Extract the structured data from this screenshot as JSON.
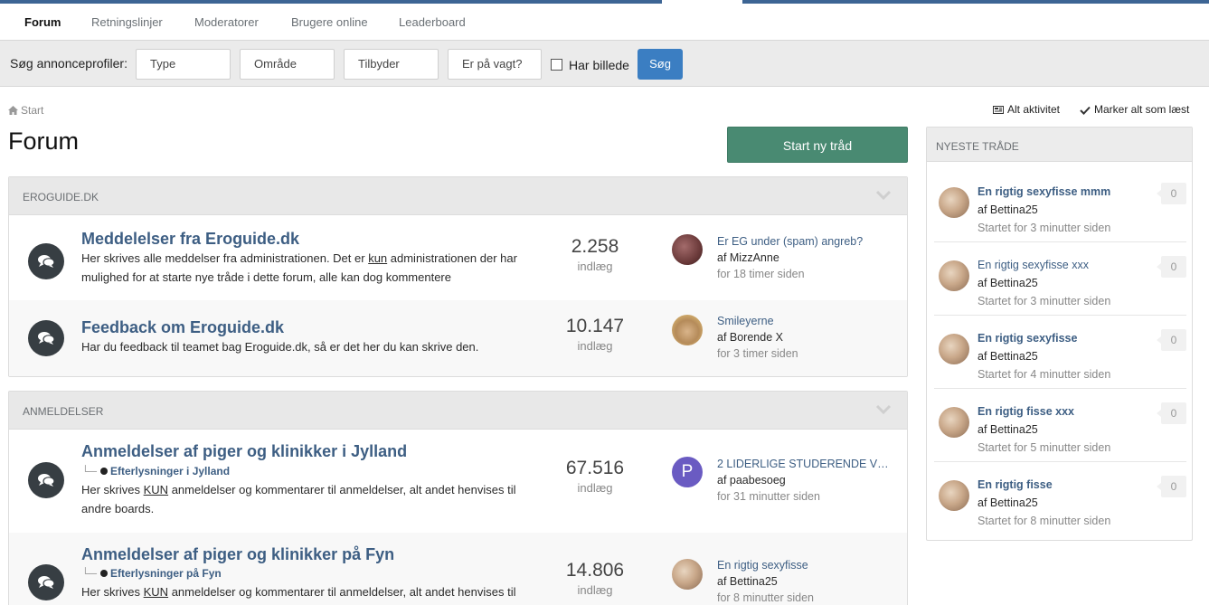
{
  "nav": {
    "tabs": [
      {
        "label": "Forum",
        "active": true
      },
      {
        "label": "Retningslinjer",
        "active": false
      },
      {
        "label": "Moderatorer",
        "active": false
      },
      {
        "label": "Brugere online",
        "active": false
      },
      {
        "label": "Leaderboard",
        "active": false
      }
    ]
  },
  "search": {
    "label": "Søg annonceprofiler:",
    "fields": [
      "Type",
      "Område",
      "Tilbyder",
      "Er på vagt?"
    ],
    "checkbox_label": "Har billede",
    "checkbox_checked": false,
    "button": "Søg"
  },
  "breadcrumb": {
    "home": "Start"
  },
  "page_title": "Forum",
  "actions": {
    "all_activity": "Alt aktivitet",
    "mark_read": "Marker alt som læst"
  },
  "start_thread": "Start ny tråd",
  "categories": [
    {
      "title": "EROGUIDE.DK",
      "forums": [
        {
          "title": "Meddelelser fra Eroguide.dk",
          "desc_a": "Her skrives alle meddelser fra administrationen. Det er ",
          "desc_u": "kun",
          "desc_b": " administrationen der har mulighed for at starte nye tråde i dette forum, alle kan dog kommentere",
          "count": "2.258",
          "count_label": "indlæg",
          "last_title": "Er EG under (spam) angreb?",
          "last_by": "af MizzAnne",
          "last_when": "for 18 timer siden"
        },
        {
          "title": "Feedback om Eroguide.dk",
          "desc_a": "Har du feedback til teamet bag Eroguide.dk, så er det her du kan skrive den.",
          "count": "10.147",
          "count_label": "indlæg",
          "last_title": "Smileyerne",
          "last_by": "af Borende X",
          "last_when": "for 3 timer siden"
        }
      ]
    },
    {
      "title": "ANMELDELSER",
      "forums": [
        {
          "title": "Anmeldelser af piger og klinikker i Jylland",
          "sub": "Efterlysninger i Jylland",
          "desc_a": "Her skrives ",
          "desc_u": "KUN",
          "desc_b": " anmeldelser og kommentarer til anmeldelser, alt andet henvises til andre boards.",
          "count": "67.516",
          "count_label": "indlæg",
          "avatar_letter": "P",
          "last_title": "2 LIDERLIGE STUDERENDE VEN…",
          "last_by": "af paabesoeg",
          "last_when": "for 31 minutter siden"
        },
        {
          "title": "Anmeldelser af piger og klinikker på Fyn",
          "sub": "Efterlysninger på Fyn",
          "desc_a": "Her skrives ",
          "desc_u": "KUN",
          "desc_b": " anmeldelser og kommentarer til anmeldelser, alt andet henvises til",
          "count": "14.806",
          "count_label": "indlæg",
          "last_title": "En rigtig sexyfisse",
          "last_by": "af Bettina25",
          "last_when": "for 8 minutter siden"
        }
      ]
    }
  ],
  "sidebar": {
    "title": "NYESTE TRÅDE",
    "items": [
      {
        "title": "En rigtig sexyfisse mmm",
        "by": "af Bettina25",
        "when": "Startet for 3 minutter siden",
        "count": "0"
      },
      {
        "title": "En rigtig sexyfisse xxx",
        "by": "af Bettina25",
        "when": "Startet for 3 minutter siden",
        "count": "0"
      },
      {
        "title": "En rigtig sexyfisse",
        "by": "af Bettina25",
        "when": "Startet for 4 minutter siden",
        "count": "0"
      },
      {
        "title": "En rigtig fisse xxx",
        "by": "af Bettina25",
        "when": "Startet for 5 minutter siden",
        "count": "0"
      },
      {
        "title": "En rigtig fisse",
        "by": "af Bettina25",
        "when": "Startet for 8 minutter siden",
        "count": "0"
      }
    ]
  },
  "colors": {
    "accent": "#3d6594",
    "start_button": "#498a72",
    "search_button": "#3b7ec2",
    "link": "#3d5e83"
  }
}
